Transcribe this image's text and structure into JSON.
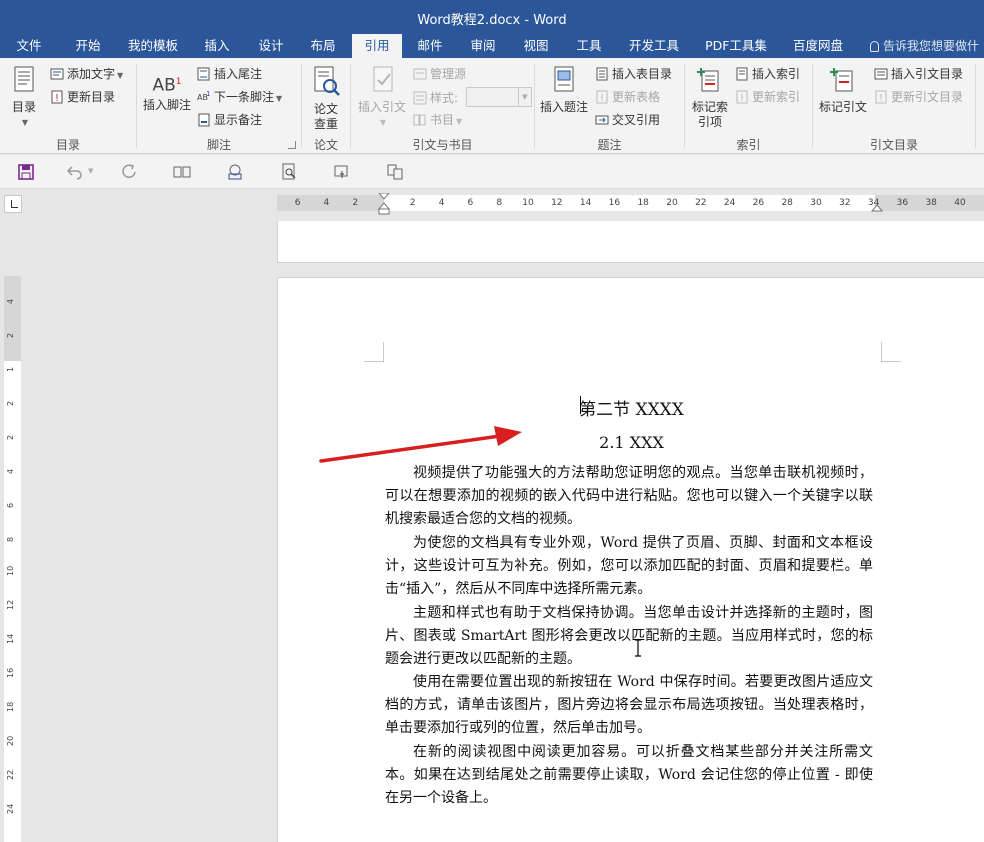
{
  "window": {
    "title": "Word教程2.docx - Word"
  },
  "tabs": [
    {
      "label": "文件",
      "active": false
    },
    {
      "label": "开始",
      "active": false
    },
    {
      "label": "我的模板",
      "active": false
    },
    {
      "label": "插入",
      "active": false
    },
    {
      "label": "设计",
      "active": false
    },
    {
      "label": "布局",
      "active": false
    },
    {
      "label": "引用",
      "active": true
    },
    {
      "label": "邮件",
      "active": false
    },
    {
      "label": "审阅",
      "active": false
    },
    {
      "label": "视图",
      "active": false
    },
    {
      "label": "工具",
      "active": false
    },
    {
      "label": "开发工具",
      "active": false
    },
    {
      "label": "PDF工具集",
      "active": false
    },
    {
      "label": "百度网盘",
      "active": false
    }
  ],
  "tell_me": "告诉我您想要做什",
  "ribbon": {
    "toc": {
      "big": "目录",
      "add_text": "添加文字",
      "update": "更新目录",
      "group": "目录"
    },
    "footnotes": {
      "insert_footnote": "插入脚注",
      "insert_endnote": "插入尾注",
      "next_footnote": "下一条脚注",
      "show_notes": "显示备注",
      "group": "脚注",
      "ab_label": "AB"
    },
    "paper": {
      "check": "论文查重",
      "group": "论文"
    },
    "citations": {
      "insert_citation": "插入引文",
      "manage_sources": "管理源",
      "style": "样式:",
      "bibliography": "书目",
      "group": "引文与书目"
    },
    "captions": {
      "insert_caption": "插入题注",
      "insert_tof": "插入表目录",
      "update_table": "更新表格",
      "cross_ref": "交叉引用",
      "group": "题注"
    },
    "index": {
      "mark_entry": "标记索引项",
      "insert_index": "插入索引",
      "update_index": "更新索引",
      "group": "索引"
    },
    "toa": {
      "mark_citation": "标记引文",
      "insert_toa": "插入引文目录",
      "update_toa": "更新引文目录",
      "group": "引文目录"
    }
  },
  "ruler": {
    "h_ticks": [
      "6",
      "4",
      "2",
      "2",
      "4",
      "6",
      "8",
      "10",
      "12",
      "14",
      "16",
      "18",
      "20",
      "22",
      "24",
      "26",
      "28",
      "30",
      "32",
      "34",
      "36",
      "38",
      "40"
    ],
    "v_ticks": [
      "4",
      "2",
      "1",
      "2",
      "2",
      "4",
      "6",
      "8",
      "10",
      "12",
      "14",
      "16",
      "18",
      "20",
      "22",
      "24"
    ]
  },
  "document": {
    "heading1": "第二节  XXXX",
    "heading2": "2.1 XXX",
    "paragraphs": [
      "视频提供了功能强大的方法帮助您证明您的观点。当您单击联机视频时，可以在想要添加的视频的嵌入代码中进行粘贴。您也可以键入一个关键字以联机搜索最适合您的文档的视频。",
      "为使您的文档具有专业外观，Word 提供了页眉、页脚、封面和文本框设计，这些设计可互为补充。例如，您可以添加匹配的封面、页眉和提要栏。单击“插入”，然后从不同库中选择所需元素。",
      "主题和样式也有助于文档保持协调。当您单击设计并选择新的主题时，图片、图表或 SmartArt 图形将会更改以匹配新的主题。当应用样式时，您的标题会进行更改以匹配新的主题。",
      "使用在需要位置出现的新按钮在 Word 中保存时间。若要更改图片适应文档的方式，请单击该图片，图片旁边将会显示布局选项按钮。当处理表格时，单击要添加行或列的位置，然后单击加号。",
      "在新的阅读视图中阅读更加容易。可以折叠文档某些部分并关注所需文本。如果在达到结尾处之前需要停止读取，Word 会记住您的停止位置 - 即使在另一个设备上。"
    ]
  },
  "colors": {
    "brand": "#2b579a",
    "arrow": "#d81e1e"
  }
}
